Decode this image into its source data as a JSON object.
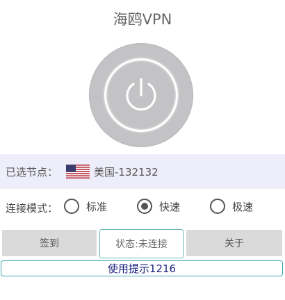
{
  "app": {
    "title": "海鸥VPN"
  },
  "node": {
    "label": "已选节点：",
    "value": "美国-132132",
    "flag_icon": "us-flag-icon"
  },
  "mode": {
    "label": "连接模式：",
    "options": [
      "标准",
      "快速",
      "极速"
    ],
    "selected": "快速"
  },
  "actions": {
    "checkin_label": "签到",
    "status_text": "状态:未连接",
    "about_label": "关于"
  },
  "tip": {
    "text": "使用提示1216"
  },
  "colors": {
    "power_button": "#c3c3c6",
    "node_row_bg": "#eeeefa",
    "status_border": "#6cb8b4",
    "tip_text": "#1a237e",
    "tip_border": "#3fa3b3"
  }
}
